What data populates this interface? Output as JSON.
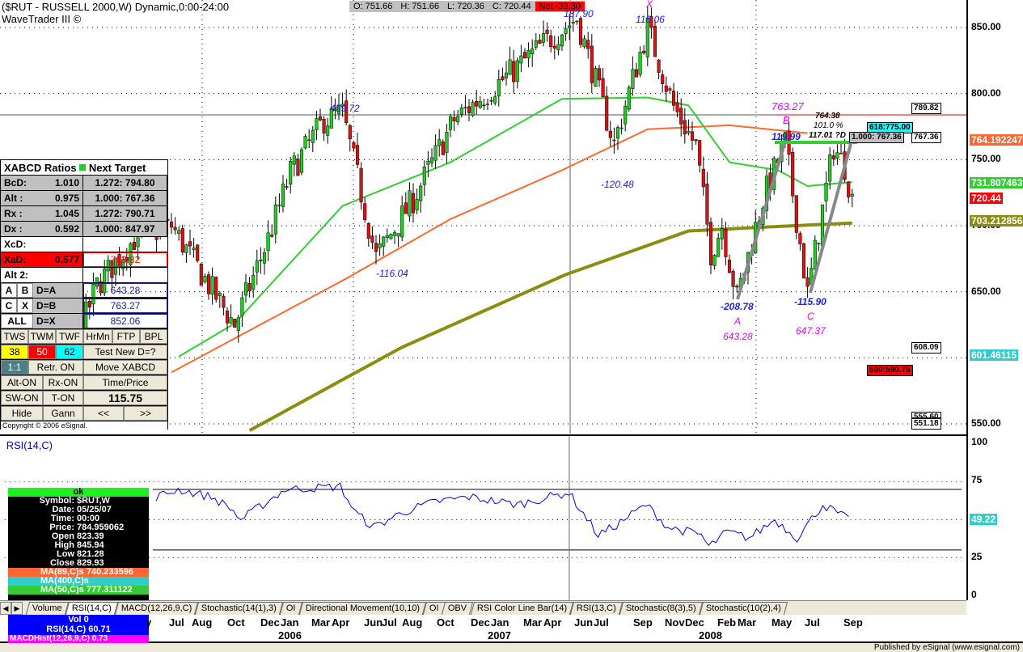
{
  "header": {
    "title": "($RUT - RUSSELL 2000,W) Dynamic,0:00-24:00",
    "subtitle": "WaveTrader III ©",
    "open": "O: 751.66",
    "high": "H: 751.66",
    "low": "L: 720.36",
    "close": "C: 720.44",
    "net": "Net -33.30"
  },
  "colors": {
    "up": "#22cc22",
    "down": "#dd1111",
    "ma50": "#33cc33",
    "ma89": "#ff6a2a",
    "ma400": "#8c8c10",
    "rsi": "#0000dd",
    "pattern": "#888888"
  },
  "price_axis": {
    "ticks": [
      "850.00",
      "800.00",
      "750.00",
      "700.00",
      "650.00",
      "600.00",
      "550.00"
    ],
    "tags": {
      "ma89": "764.192247",
      "ma50": "731.807463",
      "last": "720.44",
      "ma400": "703.212856",
      "cyan": "601.46115"
    },
    "boxes": {
      "b1": "789.82",
      "b2": "767.36",
      "b3": "608.09",
      "b4": "555.60",
      "b5": "551.18",
      "t1": "618:775.00",
      "t2": "1.000: 767.36",
      "t3": "500:590.75"
    }
  },
  "annotations": {
    "p1": "459.72",
    "p2": "-116.04",
    "p3": "187.90",
    "p4": "-120.48",
    "p5": "X",
    "p6": "116.06",
    "p7": "763.27",
    "p8": "B",
    "p9": "119.99",
    "p10": "764.38",
    "p11": "101.0 %",
    "p12": "117.01 ?D",
    "p13": "-208.78",
    "p14": "A",
    "p15": "643.28",
    "p16": "-115.90",
    "p17": "C",
    "p18": "647.37"
  },
  "xabcd": {
    "title": "XABCD Ratios",
    "next": "Next Target",
    "rows": [
      {
        "k": "BcD:",
        "v": "1.010",
        "t": "1.272: 794.80"
      },
      {
        "k": "Alt  :",
        "v": "0.975",
        "t": "1.000: 767.36"
      },
      {
        "k": "Rx   :",
        "v": "1.045",
        "t": "1.272: 790.71"
      },
      {
        "k": "Dx   :",
        "v": "0.592",
        "t": "1.000: 847.97"
      }
    ],
    "xcd": "XcD:",
    "xad": "XaD:",
    "xad_v": "0.577",
    "xad_t": "763.82",
    "alt2": "Alt 2:",
    "pts": {
      "a": "A",
      "b": "B",
      "c": "C",
      "x": "X",
      "all": "ALL",
      "da": "D=A",
      "db": "D=B",
      "dx": "D=X",
      "va": "643.28",
      "vb": "763.27",
      "vx": "852.06"
    },
    "btns": {
      "tws": "TWS",
      "twm": "TWM",
      "twf": "TWF",
      "hrmn": "HrMn",
      "ftp": "FTP",
      "bpl": "BPL",
      "f38": "38",
      "f50": "50",
      "f62": "62",
      "test": "Test New D=?",
      "r11": "1:1",
      "retr": "Retr. ON",
      "move": "Move XABCD",
      "alt": "Alt-ON",
      "rx": "Rx-ON",
      "tp": "Time/Price",
      "sw": "SW-ON",
      "t": "T-ON",
      "val": "115.75",
      "hide": "Hide",
      "gann": "Gann",
      "prev": "<<",
      "next": ">>"
    },
    "copyright": "Copyright © 2006 eSignal."
  },
  "rsi": {
    "label": "RSI(14,C)",
    "ticks": [
      "100",
      "75",
      "25",
      "0"
    ],
    "value": "49.22"
  },
  "data_window": {
    "status": "ok",
    "rows": [
      [
        "Symbol:",
        "$RUT,W"
      ],
      [
        "Date:",
        "05/25/07"
      ],
      [
        "Time:",
        "00:00"
      ],
      [
        "Price:",
        "784.959062"
      ],
      [
        "Open",
        "823.39"
      ],
      [
        "High",
        "845.94"
      ],
      [
        "Low",
        "821.28"
      ],
      [
        "Close",
        "829.93"
      ]
    ],
    "ma89": "MA(89,C)s 740.233596",
    "ma400": "MA(400,C)s",
    "ma50": "MA(50,C)s 777.311122",
    "vol": "Vol 0",
    "rsi": "RSI(14,C) 60.71",
    "macd": "MACDHist(12,26,9,C) 0.73"
  },
  "tabs": [
    "Volume",
    "RSI(14,C)",
    "MACD(12,26,9,C)",
    "Stochastic(14(1),3)",
    "OI",
    "Directional Movement(10,10)",
    "OI",
    "OBV",
    "RSI Color Line Bar(14)",
    "RSI(13,C)",
    "Stochastic(8(3),5)",
    "Stochastic(10(2),4)"
  ],
  "date_axis": {
    "months": [
      "y",
      "Jul",
      "Aug",
      "Oct",
      "Dec",
      "Jan",
      "Mar",
      "Apr",
      "Jun",
      "Jul",
      "Aug",
      "Oct",
      "Dec",
      "Jan",
      "Mar",
      "Apr",
      "Jun",
      "Jul",
      "Sep",
      "Nov",
      "Dec",
      "Feb",
      "Mar",
      "May",
      "Jul",
      "Sep"
    ],
    "years": [
      "2006",
      "2007",
      "2008"
    ]
  },
  "status": "Published by eSignal (www.esignal.com)",
  "chart_data": {
    "type": "candlestick",
    "weeks": 229,
    "ylim": [
      550,
      860
    ],
    "close_pivots": [
      [
        0,
        575
      ],
      [
        10,
        630
      ],
      [
        18,
        600
      ],
      [
        25,
        655
      ],
      [
        35,
        690
      ],
      [
        45,
        700
      ],
      [
        55,
        655
      ],
      [
        62,
        625
      ],
      [
        71,
        690
      ],
      [
        77,
        740
      ],
      [
        86,
        780
      ],
      [
        91,
        785
      ],
      [
        100,
        676
      ],
      [
        110,
        720
      ],
      [
        121,
        780
      ],
      [
        138,
        820
      ],
      [
        146,
        840
      ],
      [
        154,
        857
      ],
      [
        161,
        790
      ],
      [
        164,
        762
      ],
      [
        173,
        850
      ],
      [
        180,
        790
      ],
      [
        186,
        760
      ],
      [
        190,
        680
      ],
      [
        193,
        700
      ],
      [
        197,
        645
      ],
      [
        204,
        720
      ],
      [
        210,
        763
      ],
      [
        216,
        648
      ],
      [
        223,
        760
      ],
      [
        226,
        745
      ],
      [
        228,
        720
      ]
    ],
    "ma50": [
      [
        47,
        601
      ],
      [
        62,
        626
      ],
      [
        91,
        715
      ],
      [
        120,
        748
      ],
      [
        150,
        796
      ],
      [
        173,
        797
      ],
      [
        184,
        791
      ],
      [
        195,
        748
      ],
      [
        208,
        742
      ],
      [
        216,
        730
      ],
      [
        228,
        733
      ]
    ],
    "ma89": [
      [
        45,
        589
      ],
      [
        92,
        660
      ],
      [
        120,
        705
      ],
      [
        150,
        742
      ],
      [
        173,
        773
      ],
      [
        195,
        776
      ],
      [
        216,
        770
      ]
    ],
    "ma400": [
      [
        66,
        545
      ],
      [
        107,
        608
      ],
      [
        151,
        663
      ],
      [
        184,
        696
      ],
      [
        205,
        699
      ],
      [
        228,
        702
      ]
    ],
    "rsi": [
      [
        40,
        65
      ],
      [
        46,
        70
      ],
      [
        55,
        65
      ],
      [
        60,
        58
      ],
      [
        63,
        50
      ],
      [
        75,
        70
      ],
      [
        90,
        72
      ],
      [
        94,
        55
      ],
      [
        99,
        45
      ],
      [
        107,
        55
      ],
      [
        116,
        62
      ],
      [
        125,
        65
      ],
      [
        138,
        60
      ],
      [
        152,
        68
      ],
      [
        160,
        40
      ],
      [
        164,
        45
      ],
      [
        173,
        60
      ],
      [
        179,
        45
      ],
      [
        188,
        40
      ],
      [
        190,
        32
      ],
      [
        195,
        42
      ],
      [
        201,
        38
      ],
      [
        208,
        50
      ],
      [
        214,
        38
      ],
      [
        221,
        60
      ],
      [
        228,
        50
      ]
    ],
    "rsi_levels": [
      70,
      30
    ]
  }
}
